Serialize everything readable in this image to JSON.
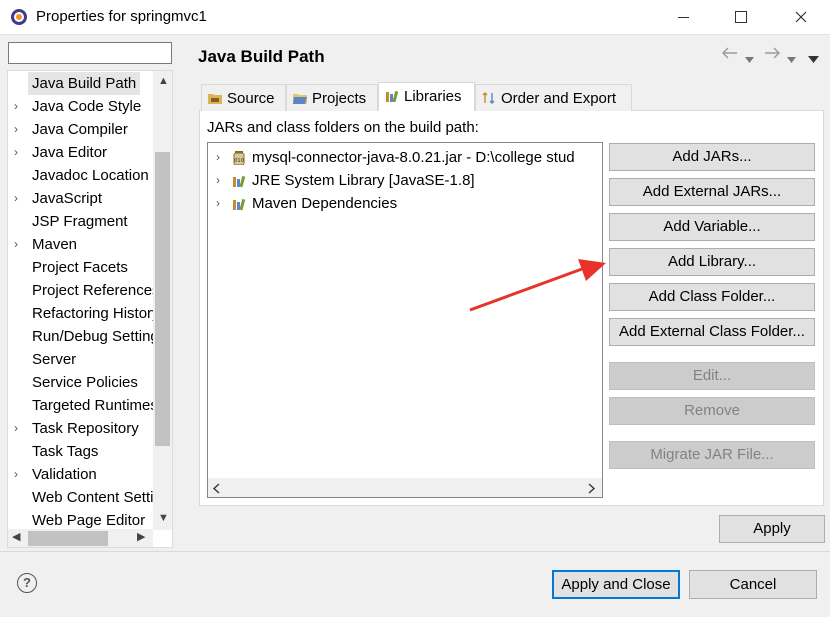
{
  "window": {
    "title": "Properties for springmvc1"
  },
  "sidebar": {
    "filter_value": "",
    "items": [
      {
        "label": "Java Build Path",
        "arrow": ""
      },
      {
        "label": "Java Code Style",
        "arrow": "›"
      },
      {
        "label": "Java Compiler",
        "arrow": "›"
      },
      {
        "label": "Java Editor",
        "arrow": "›"
      },
      {
        "label": "Javadoc Location",
        "arrow": ""
      },
      {
        "label": "JavaScript",
        "arrow": "›"
      },
      {
        "label": "JSP Fragment",
        "arrow": ""
      },
      {
        "label": "Maven",
        "arrow": "›"
      },
      {
        "label": "Project Facets",
        "arrow": ""
      },
      {
        "label": "Project References",
        "arrow": ""
      },
      {
        "label": "Refactoring History",
        "arrow": ""
      },
      {
        "label": "Run/Debug Settings",
        "arrow": ""
      },
      {
        "label": "Server",
        "arrow": ""
      },
      {
        "label": "Service Policies",
        "arrow": ""
      },
      {
        "label": "Targeted Runtimes",
        "arrow": ""
      },
      {
        "label": "Task Repository",
        "arrow": "›"
      },
      {
        "label": "Task Tags",
        "arrow": ""
      },
      {
        "label": "Validation",
        "arrow": "›"
      },
      {
        "label": "Web Content Settings",
        "arrow": ""
      },
      {
        "label": "Web Page Editor",
        "arrow": ""
      }
    ]
  },
  "main": {
    "title": "Java Build Path",
    "tabs": [
      {
        "label": "Source"
      },
      {
        "label": "Projects"
      },
      {
        "label": "Libraries"
      },
      {
        "label": "Order and Export"
      }
    ],
    "subtitle": "JARs and class folders on the build path:",
    "libraries": [
      {
        "label": "mysql-connector-java-8.0.21.jar - D:\\college stud",
        "icon": "jar-icon"
      },
      {
        "label": "JRE System Library [JavaSE-1.8]",
        "icon": "library-icon"
      },
      {
        "label": "Maven Dependencies",
        "icon": "library-icon"
      }
    ],
    "buttons": {
      "add_jars": "Add JARs...",
      "add_external_jars": "Add External JARs...",
      "add_variable": "Add Variable...",
      "add_library": "Add Library...",
      "add_class_folder": "Add Class Folder...",
      "add_external_class_folder": "Add External Class Folder...",
      "edit": "Edit...",
      "remove": "Remove",
      "migrate": "Migrate JAR File..."
    },
    "apply": "Apply"
  },
  "footer": {
    "help": "?",
    "apply_and_close": "Apply and Close",
    "cancel": "Cancel"
  },
  "colors": {
    "accent": "#0078d7",
    "annotation_arrow": "#e8322b"
  }
}
